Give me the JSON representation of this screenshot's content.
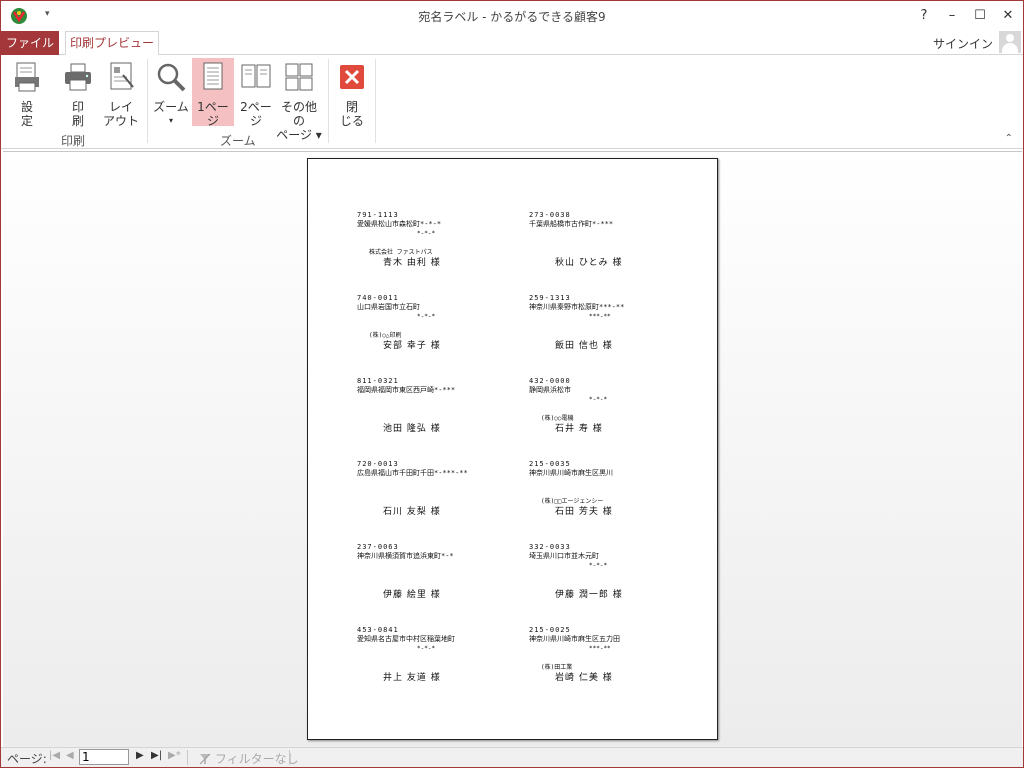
{
  "window": {
    "title": "宛名ラベル - かるがるできる顧客9",
    "help": "?",
    "minimize": "–",
    "maximize": "☐",
    "close": "✕",
    "qat_dropdown": "▾"
  },
  "tabs": {
    "file": "ファイル",
    "print_preview": "印刷プレビュー",
    "signin": "サインイン"
  },
  "ribbon": {
    "groups": {
      "print": "印刷",
      "zoom": "ズーム"
    },
    "buttons": {
      "settings": [
        "設",
        "定"
      ],
      "print": [
        "印",
        "刷"
      ],
      "layout": [
        "レイ",
        "アウト"
      ],
      "zoom": "ズーム",
      "zoom_caret": "▾",
      "one_page": [
        "1ペー",
        "ジ"
      ],
      "two_page": [
        "2ペー",
        "ジ"
      ],
      "other_pages": [
        "その他の",
        "ページ ▾"
      ],
      "close": [
        "閉",
        "じる"
      ]
    },
    "collapse": "⌃",
    "accent": "#a4373a",
    "selected_bg": "#f4c0c2",
    "close_red": "#e04a3c"
  },
  "labels": [
    {
      "zip": "791-1113",
      "addr": "愛媛県松山市森松町*-*-*",
      "addr2": "*-*-*",
      "company": "株式会社 ファストパス",
      "name": "青木 由利 様"
    },
    {
      "zip": "273-0038",
      "addr": "千葉県船橋市古作町*-***",
      "addr2": "",
      "company": "",
      "name": "秋山 ひとみ 様"
    },
    {
      "zip": "740-0011",
      "addr": "山口県岩国市立石町",
      "addr2": "*-*-*",
      "company": "(株)○△印刷",
      "name": "安部 幸子 様"
    },
    {
      "zip": "259-1313",
      "addr": "神奈川県秦野市松原町***-**",
      "addr2": "***-**",
      "company": "",
      "name": "飯田 信也 様"
    },
    {
      "zip": "811-0321",
      "addr": "福岡県福岡市東区西戸崎*-***",
      "addr2": "",
      "company": "",
      "name": "池田 隆弘 様"
    },
    {
      "zip": "432-0000",
      "addr": "静岡県浜松市",
      "addr2": "*-*-*",
      "company": "(株)○○電機",
      "name": "石井 寿 様"
    },
    {
      "zip": "720-0013",
      "addr": "広島県福山市千田町千田*-***-**",
      "addr2": "",
      "company": "",
      "name": "石川 友梨 様"
    },
    {
      "zip": "215-0035",
      "addr": "神奈川県川崎市麻生区黒川",
      "addr2": "",
      "company": "(株)□□エージェンシー",
      "name": "石田 芳夫 様"
    },
    {
      "zip": "237-0063",
      "addr": "神奈川県横須賀市追浜東町*-*",
      "addr2": "",
      "company": "",
      "name": "伊藤 絵里 様"
    },
    {
      "zip": "332-0033",
      "addr": "埼玉県川口市並木元町",
      "addr2": "*-*-*",
      "company": "",
      "name": "伊藤 潤一郎 様"
    },
    {
      "zip": "453-0841",
      "addr": "愛知県名古屋市中村区稲葉地町",
      "addr2": "*-*-*",
      "company": "",
      "name": "井上 友道 様"
    },
    {
      "zip": "215-0025",
      "addr": "神奈川県川崎市麻生区五力田",
      "addr2": "***-**",
      "company": "(株)田工業",
      "name": "岩崎 仁美 様"
    }
  ],
  "status": {
    "page_label": "ページ:",
    "first": "|◀",
    "prev": "◀",
    "page_value": "1",
    "next": "▶",
    "last": "▶|",
    "new": "▶*",
    "filter": "フィルターなし"
  }
}
